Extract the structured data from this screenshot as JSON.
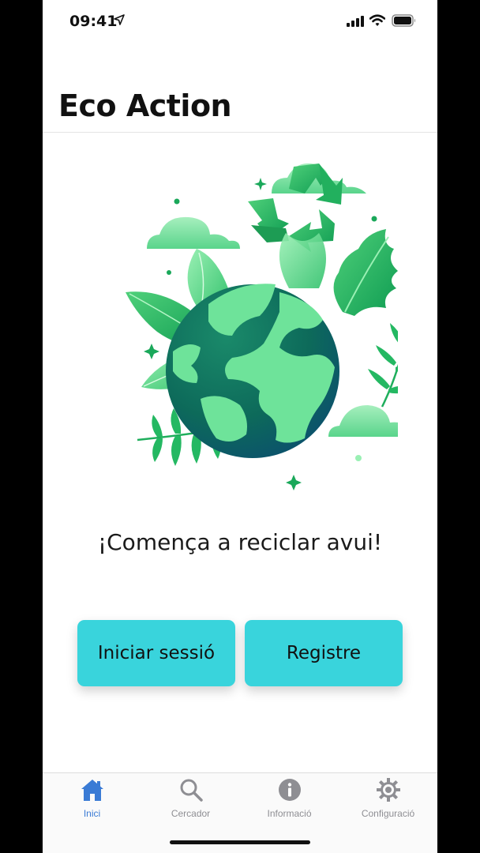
{
  "status_bar": {
    "time": "09:41"
  },
  "nav": {
    "title": "Eco Action"
  },
  "main": {
    "headline": "¡Comença a reciclar avui!",
    "login_label": "Iniciar sessió",
    "register_label": "Registre"
  },
  "tabs": [
    {
      "label": "Inici",
      "icon": "home-icon",
      "active": true
    },
    {
      "label": "Cercador",
      "icon": "search-icon",
      "active": false
    },
    {
      "label": "Informació",
      "icon": "info-icon",
      "active": false
    },
    {
      "label": "Configuració",
      "icon": "gear-icon",
      "active": false
    }
  ],
  "colors": {
    "accent": "#39d4dc",
    "tab_active": "#3a7bd5",
    "tab_inactive": "#8e8e93",
    "globe_ocean": "#0e6b5c",
    "globe_land": "#6ee39a"
  }
}
